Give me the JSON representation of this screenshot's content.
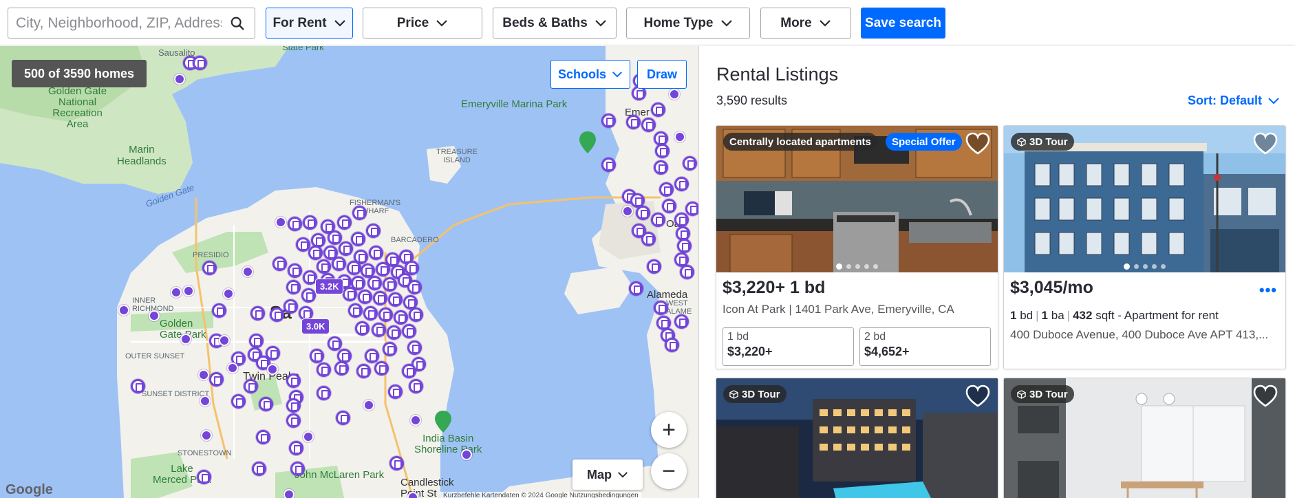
{
  "search": {
    "placeholder": "City, Neighborhood, ZIP, Address"
  },
  "filters": [
    {
      "label": "For Rent"
    },
    {
      "label": "Price"
    },
    {
      "label": "Beds & Baths"
    },
    {
      "label": "Home Type"
    },
    {
      "label": "More"
    }
  ],
  "save_search_label": "Save search",
  "map": {
    "result_pill": "500 of 3590 homes",
    "schools_label": "Schools",
    "draw_label": "Draw",
    "map_type_label": "Map",
    "zoom_in": "+",
    "zoom_out": "−",
    "provider": "Google",
    "attribution": "Kurzbefehle   Kartendaten © 2024 Google   Nutzungsbedingungen",
    "cluster_1": "3.2K",
    "cluster_2": "3.0K",
    "labels": {
      "sausalito": "Sausalito",
      "state_park": "State Park",
      "golden_gate_nra": "Golden Gate\nNational\nRecreation\nArea",
      "marin_headlands": "Marin\nHeadlands",
      "golden_gate": "Golden Gate",
      "presidio": "PRESIDIO",
      "richmond": "INNER\nRICHMOND",
      "golden_gate_park": "Golden\nGate Park",
      "outer_sunset": "OUTER SUNSET",
      "sunset_district": "SUNSET DISTRICT",
      "twin_peaks": "Twin Peaks",
      "stonestown": "STONESTOWN",
      "lake_merced": "Lake\nMerced Park",
      "mclaren": "John McLaren Park",
      "candlestick": "Candlestick\nPoint St",
      "india_basin": "India Basin\nShoreline Park",
      "treasure_island": "TREASURE\nISLAND",
      "fishermans": "FISHERMAN'S\nWHARF",
      "embarcadero": "BARCADERO",
      "emeryville": "Emeryville Marina Park",
      "emeryville_city": "Emer",
      "alameda": "Alameda",
      "oakland": "Oa",
      "west_alameda": "WEST\nALAME",
      "sf_big": "Sa"
    }
  },
  "listings": {
    "title": "Rental Listings",
    "count": "3,590 results",
    "sort": "Sort: Default",
    "cards": [
      {
        "badge": "Centrally located apartments",
        "badge2": "Special Offer",
        "price": "$3,220+ 1 bd",
        "address": "Icon At Park | 1401 Park Ave, Emeryville, CA",
        "units": [
          {
            "beds": "1 bd",
            "price": "$3,220+"
          },
          {
            "beds": "2 bd",
            "price": "$4,652+"
          }
        ]
      },
      {
        "badge": "3D Tour",
        "price": "$3,045/mo",
        "more": "•••",
        "beds": "1",
        "beds_unit": "bd",
        "baths": "1",
        "baths_unit": "ba",
        "sqft": "432",
        "sqft_unit": "sqft",
        "type": "- Apartment for rent",
        "address": "400 Duboce Avenue, 400 Duboce Ave APT 413,..."
      },
      {
        "badge": "3D Tour"
      },
      {
        "badge": "3D Tour"
      }
    ]
  },
  "colors": {
    "accent": "#006aff",
    "marker": "#7445d8",
    "water": "#9fc2f5",
    "land": "#f2f1ec",
    "park": "#bfe3b4"
  }
}
